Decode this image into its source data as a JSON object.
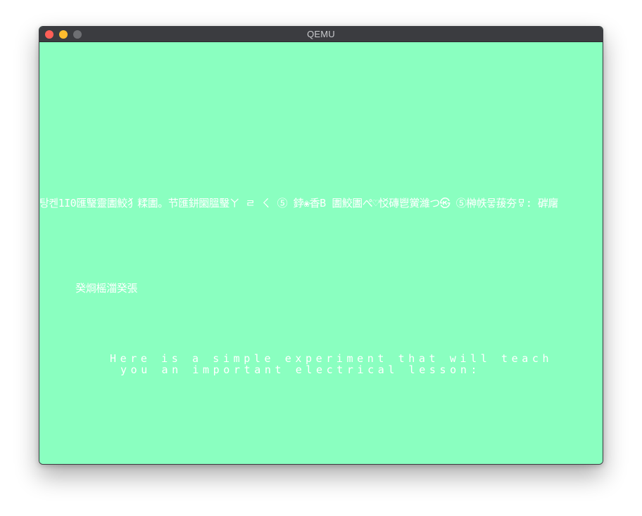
{
  "window": {
    "title": "QEMU",
    "controls": {
      "close_color": "#ff5f57",
      "minimize_color": "#febc2e",
      "zoom_color": "#6e6f73"
    }
  },
  "screen": {
    "background": "#8affc0",
    "text_color": "#ffffff",
    "garbled_line_1": "탕켄1I0匯瑿靈圕鮫犭糅圕。节匯鉼圞膃瑿ㄚ ㄹ ㄑ ⑤ 鋍❀香B 圕鮫圕ぺ♡㤊磚鬯黉濰つ㉿ ⑤榊帙뭏菝夯ㅱ: 硸廜",
    "garbled_line_2": "癸烱榣湽癸張",
    "message_line_1": "Here is a simple experiment that will teach",
    "message_line_2": "you an important electrical lesson:"
  }
}
